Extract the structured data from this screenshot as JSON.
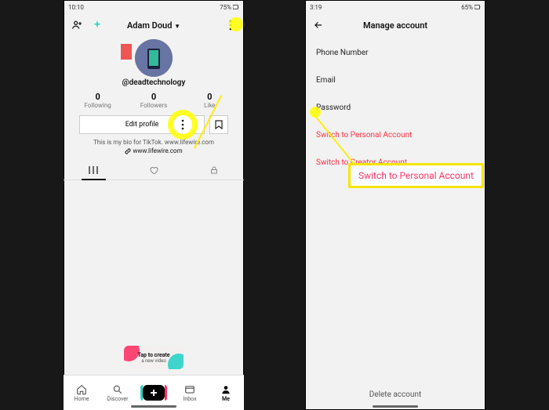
{
  "left": {
    "status": {
      "time": "10:10",
      "battery": "75%"
    },
    "header": {
      "name": "Adam Doud"
    },
    "username": "@deadtechnology",
    "stats": [
      {
        "value": "0",
        "label": "Following"
      },
      {
        "value": "0",
        "label": "Followers"
      },
      {
        "value": "0",
        "label": "Like"
      }
    ],
    "edit_label": "Edit profile",
    "bio": "This is my bio for TikTok. www.lifewire.com",
    "link": "www.lifewire.com",
    "card": {
      "title": "Tap to create",
      "sub": "a new video"
    },
    "nav": [
      "Home",
      "Discover",
      "Inbox",
      "Me"
    ]
  },
  "right": {
    "status": {
      "time": "3:19",
      "battery": "65%"
    },
    "title": "Manage account",
    "items": [
      "Phone Number",
      "Email",
      "Password",
      "Switch to Personal Account",
      "Switch to Creator Account"
    ],
    "delete": "Delete account",
    "tooltip": "Switch to Personal Account"
  }
}
